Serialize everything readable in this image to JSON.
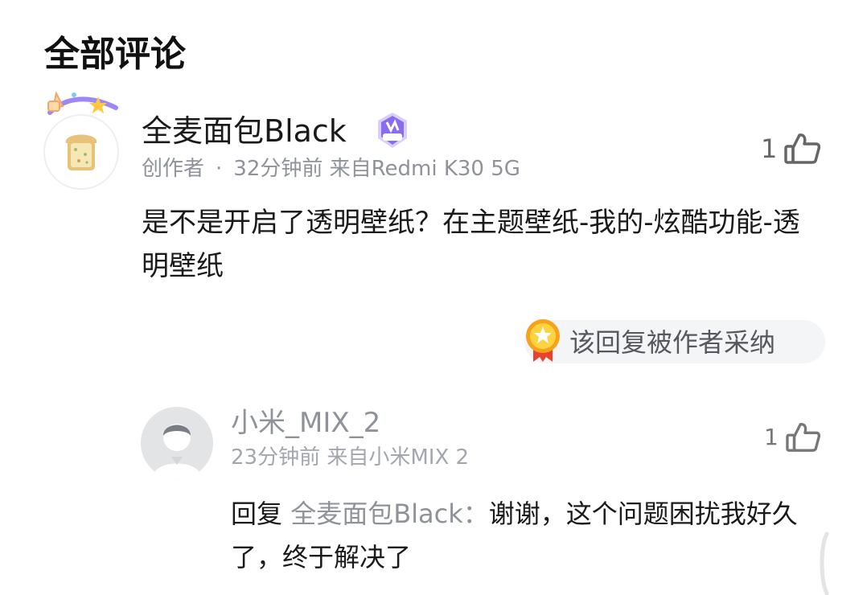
{
  "section": {
    "title": "全部评论"
  },
  "comments": [
    {
      "author": "全麦面包Black",
      "role": "创作者",
      "separator": "·",
      "meta": "32分钟前 来自Redmi K30 5G",
      "likes": "1",
      "text": "是不是开启了透明壁纸？在主题壁纸-我的-炫酷功能-透明壁纸",
      "adopted_label": "该回复被作者采纳",
      "badge_icon": "creator-badge-icon",
      "avatar_icon": "toast-avatar-icon"
    },
    {
      "author": "小米_MIX_2",
      "meta": "23分钟前 来自小米MIX 2",
      "likes": "1",
      "reply_prefix": "回复 ",
      "reply_target": "全麦面包Black：",
      "text": "谢谢，这个问题困扰我好久了，终于解决了",
      "avatar_icon": "default-user-avatar-icon"
    }
  ],
  "colors": {
    "primary_text": "#1a1a1a",
    "secondary_text": "#8f9399",
    "pill_bg": "#f4f5f6",
    "badge_purple": "#8a6cf0",
    "medal_gold": "#f6c12a",
    "medal_ribbon": "#e8432e"
  }
}
